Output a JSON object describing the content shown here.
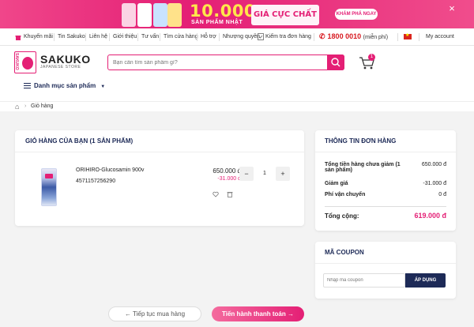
{
  "banner": {
    "headline": "10.000",
    "subline": "SẢN PHẨM NHẬT",
    "gia_chat": "GIÁ CỰC CHẤT",
    "cta": "KHÁM PHÁ NGAY",
    "close_icon": "×"
  },
  "topnav": {
    "items": [
      "Khuyến mãi",
      "Tin Sakuko",
      "Liên hệ",
      "Giới thiệu",
      "Tư vấn",
      "Tìm cửa hàng",
      "Hỗ trợ",
      "Nhượng quyền",
      "Kiểm tra đơn hàng"
    ],
    "phone": "1800 0010",
    "phone_note": "(miễn phí)",
    "account": "My account"
  },
  "header": {
    "logo_text": "SAKUKO",
    "logo_sub": "JAPANESE STORE",
    "search_placeholder": "Bạn cần tìm sản phẩm gì?",
    "cart_count": "1",
    "category_button": "Danh mục sản phẩm"
  },
  "breadcrumb": {
    "current": "Giỏ hàng"
  },
  "cart": {
    "title": "GIỎ HÀNG CỦA BẠN (1 SẢN PHẨM)",
    "items": [
      {
        "name": "ORIHIRO-Glucosamin 900v",
        "code": "4571157256290",
        "price": "650.000 đ",
        "discount": "-31.000 đ",
        "quantity": "1"
      }
    ]
  },
  "summary": {
    "title": "THÔNG TIN ĐƠN HÀNG",
    "rows": [
      {
        "label": "Tổng tiền hàng chưa giảm (1 sản phẩm)",
        "value": "650.000 đ"
      },
      {
        "label": "Giảm giá",
        "value": "-31.000 đ"
      },
      {
        "label": "Phí vận chuyển",
        "value": "0 đ"
      }
    ],
    "total_label": "Tổng cộng:",
    "total_value": "619.000 đ"
  },
  "coupon": {
    "title": "MÃ COUPON",
    "placeholder": "Nhập mã coupon",
    "apply": "ÁP DỤNG"
  },
  "actions": {
    "back": "← Tiếp tục mua hàng",
    "checkout": "Tiến hành thanh toán →"
  },
  "colors": {
    "brand": "#e41f75",
    "navy": "#1d2a57"
  }
}
